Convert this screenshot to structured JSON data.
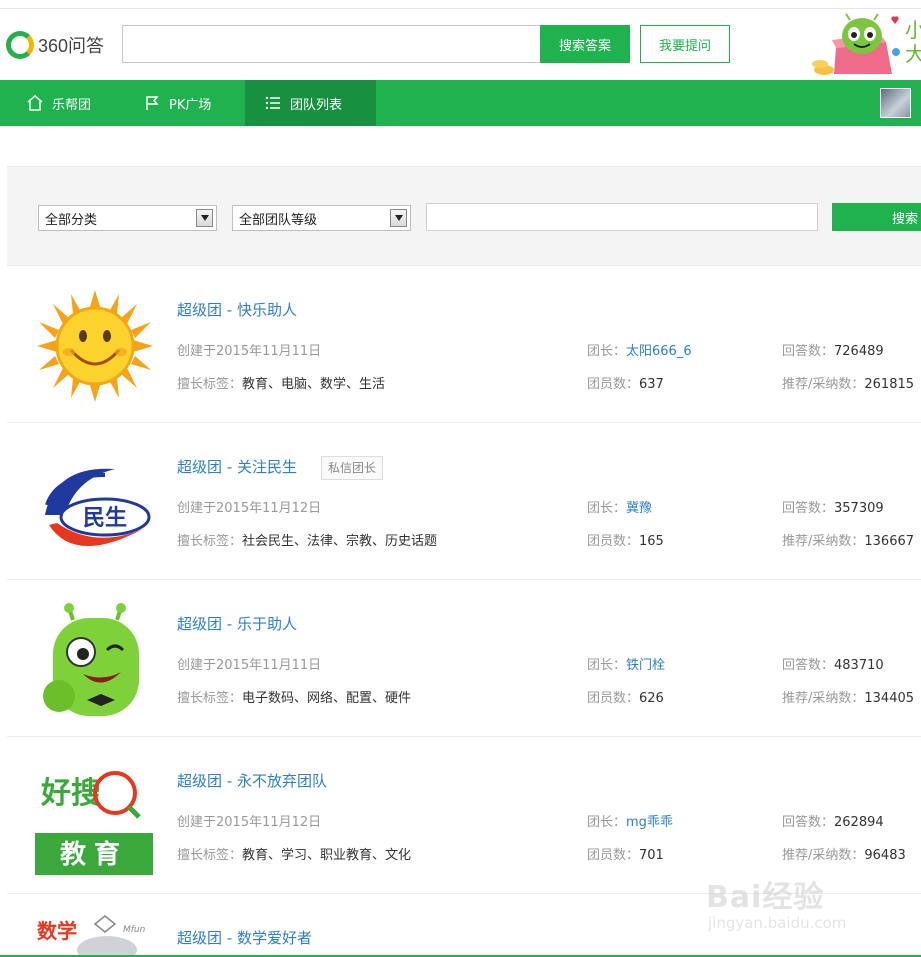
{
  "header": {
    "logo_text": "360问答",
    "search_placeholder": "",
    "search_button": "搜索答案",
    "ask_button": "我要提问",
    "side_text": "小大"
  },
  "nav": {
    "items": [
      {
        "label": "乐帮团",
        "icon": "home-icon"
      },
      {
        "label": "PK广场",
        "icon": "flag-icon"
      },
      {
        "label": "团队列表",
        "icon": "list-icon",
        "active": true
      }
    ]
  },
  "filters": {
    "category": "全部分类",
    "level": "全部团队等级",
    "keyword": "",
    "search_button": "搜索"
  },
  "labels": {
    "created_prefix": "创建于",
    "tags_prefix": "擅长标签：",
    "leader_prefix": "团长：",
    "members_prefix": "团员数：",
    "answers_prefix": "回答数：",
    "adopted_prefix": "推荐/采纳数："
  },
  "teams": [
    {
      "name": "超级团 - 快乐助人",
      "badge": "",
      "created": "2015年11月11日",
      "tags": "教育、电脑、数学、生活",
      "leader": "太阳666_6",
      "members": "637",
      "answers": "726489",
      "adopted": "261815"
    },
    {
      "name": "超级团 - 关注民生",
      "badge": "私信团长",
      "created": "2015年11月12日",
      "tags": "社会民生、法律、宗教、历史话题",
      "leader": "冀豫",
      "members": "165",
      "answers": "357309",
      "adopted": "136667"
    },
    {
      "name": "超级团 - 乐于助人",
      "badge": "",
      "created": "2015年11月11日",
      "tags": "电子数码、网络、配置、硬件",
      "leader": "铁门栓",
      "members": "626",
      "answers": "483710",
      "adopted": "134405"
    },
    {
      "name": "超级团 - 永不放弃团队",
      "badge": "",
      "created": "2015年11月12日",
      "tags": "教育、学习、职业教育、文化",
      "leader": "mg乖乖",
      "members": "701",
      "answers": "262894",
      "adopted": "96483"
    },
    {
      "name": "超级团 - 数学爱好者",
      "badge": "",
      "created": "",
      "tags": "",
      "leader": "",
      "members": "",
      "answers": "",
      "adopted": ""
    }
  ],
  "avatar_texts": {
    "team2": "民生",
    "team4_top": "好搜",
    "team4_bottom": "教育",
    "team5": "数学",
    "team5_brand": "Mfun"
  },
  "watermark": {
    "text": "Bai经验",
    "sub": "jingyan.baidu.com"
  },
  "colors": {
    "brand_green": "#1fb24f",
    "active_nav": "#17903f",
    "link_blue": "#2f7fc8"
  }
}
